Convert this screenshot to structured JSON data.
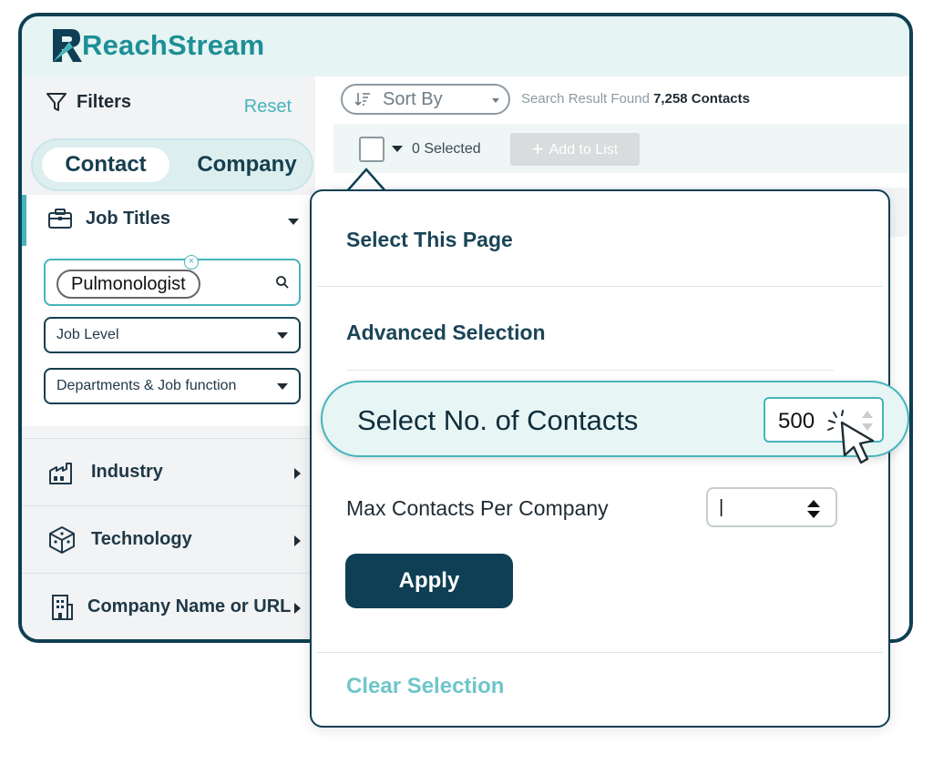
{
  "brand": {
    "name": "ReachStream"
  },
  "sidebar": {
    "filters_label": "Filters",
    "reset_label": "Reset",
    "tabs": [
      {
        "label": "Contact",
        "active": true
      },
      {
        "label": "Company",
        "active": false
      }
    ],
    "job_titles": {
      "label": "Job Titles",
      "chip": "Pulmonologist",
      "dropdowns": [
        {
          "label": "Job Level"
        },
        {
          "label": "Departments & Job function"
        }
      ]
    },
    "items": [
      {
        "label": "Industry",
        "icon": "factory-icon"
      },
      {
        "label": "Technology",
        "icon": "cube-icon"
      },
      {
        "label": "Company Name or URL",
        "icon": "building-icon"
      }
    ]
  },
  "main": {
    "sort_label": "Sort By",
    "result_prefix": "Search Result Found",
    "result_count": "7,258 Contacts",
    "selected_label": "0 Selected",
    "add_to_list_label": "Add to List"
  },
  "popover": {
    "select_page": "Select This Page",
    "advanced": "Advanced Selection",
    "select_count_label": "Select No. of Contacts",
    "select_count_value": "500",
    "max_per_company_label": "Max Contacts Per Company",
    "max_per_company_value": "|",
    "apply_label": "Apply",
    "clear_label": "Clear Selection"
  },
  "colors": {
    "accent": "#46b5bb",
    "navy": "#0f3f54",
    "brand": "#1e8f96"
  }
}
